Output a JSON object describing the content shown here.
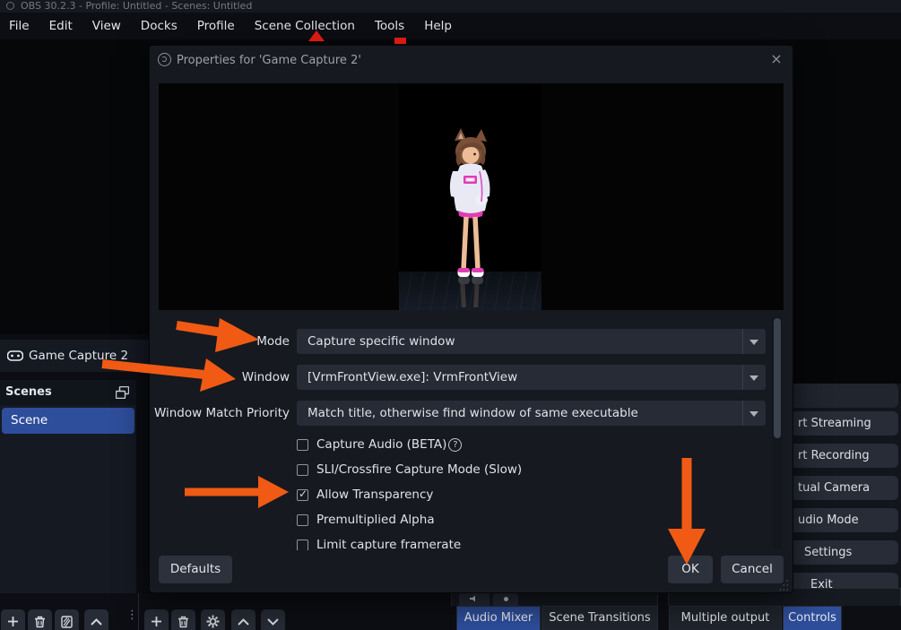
{
  "colors": {
    "accent_blue": "#2e4e9b",
    "annotation_orange": "#f05a14",
    "marker_red": "#da1a12"
  },
  "titlebar": {
    "title": "OBS 30.2.3 - Profile: Untitled - Scenes: Untitled"
  },
  "menubar": {
    "items": [
      "File",
      "Edit",
      "View",
      "Docks",
      "Profile",
      "Scene Collection",
      "Tools",
      "Help"
    ]
  },
  "dialog": {
    "title": "Properties for 'Game Capture 2'",
    "close_glyph": "×",
    "fields": [
      {
        "label": "Mode",
        "value": "Capture specific window"
      },
      {
        "label": "Window",
        "value": "[VrmFrontView.exe]: VrmFrontView"
      },
      {
        "label": "Window Match Priority",
        "value": "Match title, otherwise find window of same executable"
      }
    ],
    "checkboxes": [
      {
        "label": "Capture Audio (BETA)",
        "checked": false,
        "help_glyph": "?"
      },
      {
        "label": "SLI/Crossfire Capture Mode (Slow)",
        "checked": false
      },
      {
        "label": "Allow Transparency",
        "checked": true
      },
      {
        "label": "Premultiplied Alpha",
        "checked": false
      },
      {
        "label": "Limit capture framerate",
        "checked": false
      }
    ],
    "buttons": {
      "defaults": "Defaults",
      "ok": "OK",
      "cancel": "Cancel"
    }
  },
  "left_dock": {
    "source_label": "Game Capture 2",
    "scenes_title": "Scenes",
    "scene_name": "Scene"
  },
  "controls_dock": {
    "buttons": [
      "rt Streaming",
      "rt Recording",
      "tual Camera",
      "udio Mode",
      "Settings",
      "Exit"
    ]
  },
  "bottom_tabs": {
    "audio_mixer": "Audio Mixer",
    "scene_transitions": "Scene Transitions",
    "multiple_output": "Multiple output",
    "controls": "Controls"
  }
}
